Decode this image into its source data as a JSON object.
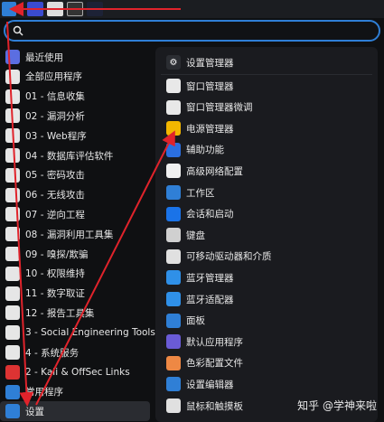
{
  "search": {
    "value": "",
    "placeholder": ""
  },
  "left_menu": [
    {
      "label": "最近使用",
      "icon": "recent-icon",
      "color": "#5b6ee1"
    },
    {
      "label": "全部应用程序",
      "icon": "all-apps-icon",
      "color": "#e6e6e6"
    },
    {
      "label": "01 - 信息收集",
      "icon": "info-gathering-icon",
      "color": "#e6e6e6"
    },
    {
      "label": "02 - 漏洞分析",
      "icon": "vuln-analysis-icon",
      "color": "#e6e6e6"
    },
    {
      "label": "03 - Web程序",
      "icon": "web-apps-icon",
      "color": "#e6e6e6"
    },
    {
      "label": "04 - 数据库评估软件",
      "icon": "database-icon",
      "color": "#e6e6e6"
    },
    {
      "label": "05 - 密码攻击",
      "icon": "password-icon",
      "color": "#e6e6e6"
    },
    {
      "label": "06 - 无线攻击",
      "icon": "wireless-icon",
      "color": "#e6e6e6"
    },
    {
      "label": "07 - 逆向工程",
      "icon": "reverse-icon",
      "color": "#e6e6e6"
    },
    {
      "label": "08 - 漏洞利用工具集",
      "icon": "exploit-icon",
      "color": "#e6e6e6"
    },
    {
      "label": "09 - 嗅探/欺骗",
      "icon": "sniff-icon",
      "color": "#e6e6e6"
    },
    {
      "label": "10 - 权限维持",
      "icon": "persistence-icon",
      "color": "#e6e6e6"
    },
    {
      "label": "11 - 数字取证",
      "icon": "forensics-icon",
      "color": "#e6e6e6"
    },
    {
      "label": "12 - 报告工具集",
      "icon": "report-icon",
      "color": "#e6e6e6"
    },
    {
      "label": "3 - Social Engineering Tools",
      "icon": "social-icon",
      "color": "#e6e6e6"
    },
    {
      "label": "4 - 系统服务",
      "icon": "services-icon",
      "color": "#e6e6e6"
    },
    {
      "label": "2 - Kali & OffSec Links",
      "icon": "kali-links-icon",
      "color": "#d33"
    },
    {
      "label": "常用程序",
      "icon": "usual-apps-icon",
      "color": "#2f7fd6"
    },
    {
      "label": "设置",
      "icon": "settings-icon",
      "color": "#2f7fd6"
    }
  ],
  "right_header": {
    "label": "设置管理器",
    "icon": "settings-manager-icon"
  },
  "right_menu": [
    {
      "label": "窗口管理器",
      "icon": "window-manager-icon",
      "color": "#e8e8e8"
    },
    {
      "label": "窗口管理器微调",
      "icon": "window-tweaks-icon",
      "color": "#e8e8e8"
    },
    {
      "label": "电源管理器",
      "icon": "power-manager-icon",
      "color": "#f2b600"
    },
    {
      "label": "辅助功能",
      "icon": "accessibility-icon",
      "color": "#2b6fe0"
    },
    {
      "label": "高级网络配置",
      "icon": "network-icon",
      "color": "#f0f0f0"
    },
    {
      "label": "工作区",
      "icon": "workspace-icon",
      "color": "#2f7fd6"
    },
    {
      "label": "会话和启动",
      "icon": "session-icon",
      "color": "#1a73e8"
    },
    {
      "label": "键盘",
      "icon": "keyboard-icon",
      "color": "#d0d0d0"
    },
    {
      "label": "可移动驱动器和介质",
      "icon": "removable-drive-icon",
      "color": "#e0e0e0"
    },
    {
      "label": "蓝牙管理器",
      "icon": "bluetooth-manager-icon",
      "color": "#2f90e8"
    },
    {
      "label": "蓝牙适配器",
      "icon": "bluetooth-adapter-icon",
      "color": "#2f90e8"
    },
    {
      "label": "面板",
      "icon": "panel-icon",
      "color": "#2f7fd6"
    },
    {
      "label": "默认应用程序",
      "icon": "default-apps-icon",
      "color": "#6a5bd6"
    },
    {
      "label": "色彩配置文件",
      "icon": "color-profile-icon",
      "color": "#e84"
    },
    {
      "label": "设置编辑器",
      "icon": "settings-editor-icon",
      "color": "#2f7fd6"
    },
    {
      "label": "鼠标和触摸板",
      "icon": "mouse-icon",
      "color": "#e0e0e0"
    }
  ],
  "watermark": "知乎 @学神来啦",
  "accent": "#2f7fd6",
  "annotation_color": "#e0232b"
}
